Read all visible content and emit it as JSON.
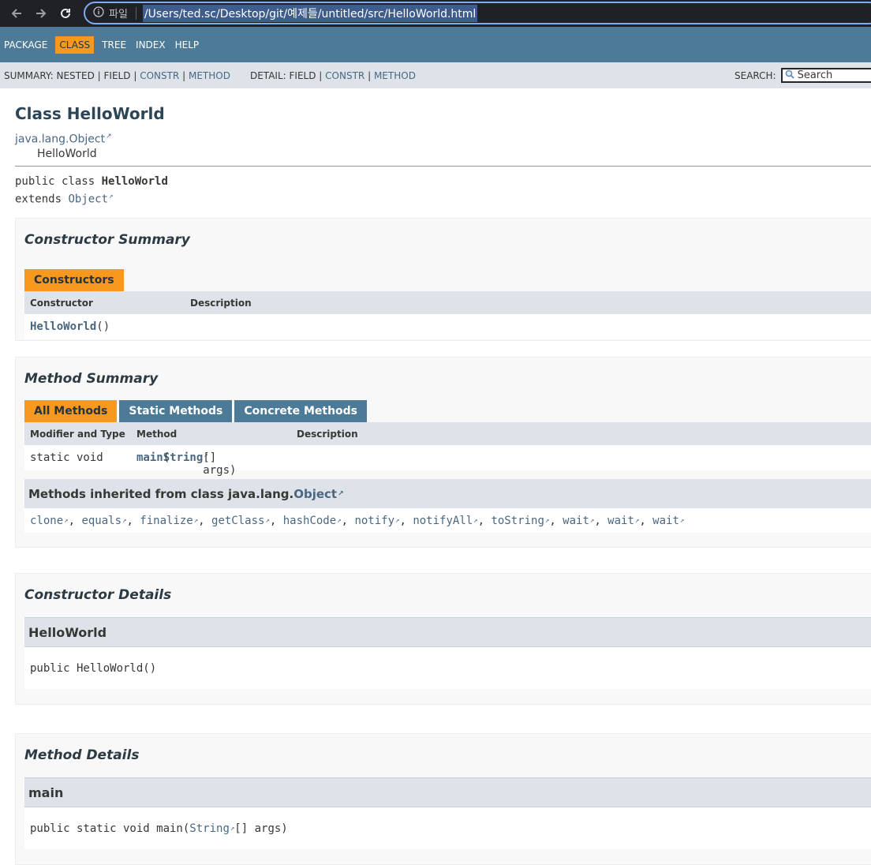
{
  "browser": {
    "scheme_label": "파일",
    "url": "/Users/ted.sc/Desktop/git/예제들/untitled/src/HelloWorld.html"
  },
  "topnav": {
    "items": [
      "PACKAGE",
      "CLASS",
      "TREE",
      "INDEX",
      "HELP"
    ],
    "active": "CLASS"
  },
  "subnav": {
    "summary_label": "SUMMARY:",
    "summary_nested": "NESTED",
    "summary_field": "FIELD",
    "summary_constr": "CONSTR",
    "summary_method": "METHOD",
    "detail_label": "DETAIL:",
    "detail_field": "FIELD",
    "detail_constr": "CONSTR",
    "detail_method": "METHOD",
    "sep": "|",
    "search_label": "SEARCH:",
    "search_placeholder": "Search"
  },
  "header": {
    "title": "Class HelloWorld",
    "parent": "java.lang.Object",
    "child": "HelloWorld"
  },
  "signature": {
    "line1_prefix": "public class",
    "class_name": "HelloWorld",
    "extends_kw": "extends",
    "extends_link": "Object"
  },
  "constructor_summary": {
    "heading": "Constructor Summary",
    "tab": "Constructors",
    "col_constructor": "Constructor",
    "col_description": "Description",
    "row_name": "HelloWorld",
    "row_params": "()"
  },
  "method_summary": {
    "heading": "Method Summary",
    "tabs": [
      "All Methods",
      "Static Methods",
      "Concrete Methods"
    ],
    "col_modifier": "Modifier and Type",
    "col_method": "Method",
    "col_description": "Description",
    "row_modifier": "static void",
    "row_method": "main",
    "row_param_type": "String",
    "row_param_rest": "[] args)",
    "row_open": "(",
    "inherited_heading_prefix": "Methods inherited from class java.lang.",
    "inherited_heading_link": "Object",
    "inherited_methods": [
      "clone",
      "equals",
      "finalize",
      "getClass",
      "hashCode",
      "notify",
      "notifyAll",
      "toString",
      "wait",
      "wait",
      "wait"
    ]
  },
  "constructor_details": {
    "heading": "Constructor Details",
    "name": "HelloWorld",
    "signature": "public HelloWorld()"
  },
  "method_details": {
    "heading": "Method Details",
    "name": "main",
    "sig_prefix": "public static void main(",
    "sig_type": "String",
    "sig_suffix": "[] args)"
  }
}
